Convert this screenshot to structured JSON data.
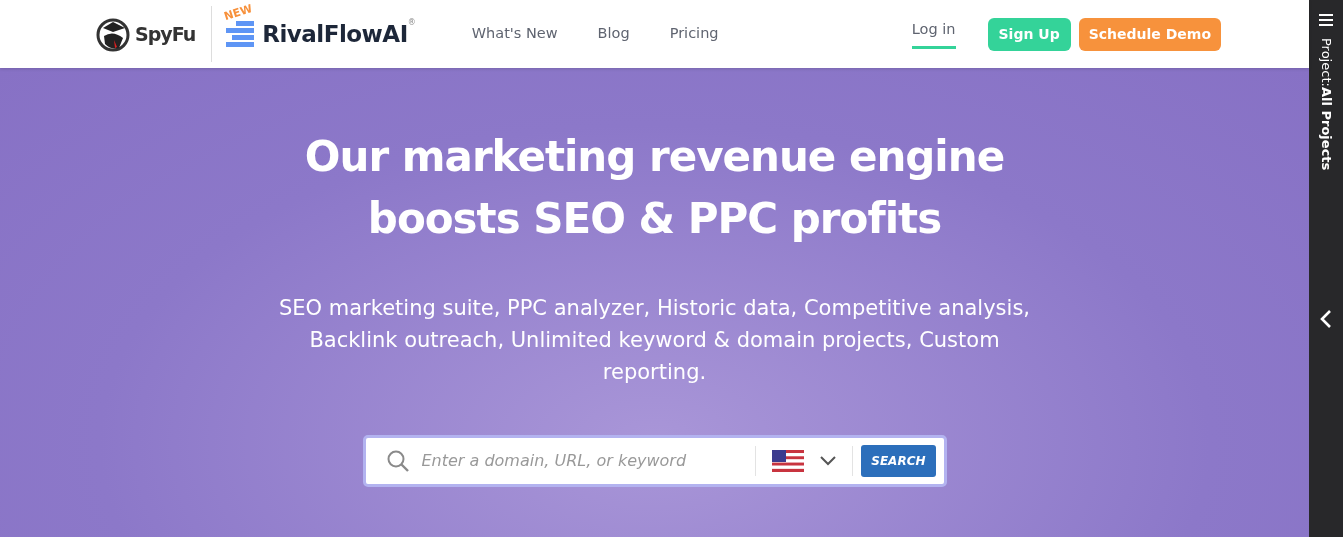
{
  "header": {
    "logo": "SpyFu",
    "product_badge": "NEW",
    "product_name": "RivalFlowAI",
    "product_mark": "®",
    "nav": [
      {
        "label": "What's New",
        "selected": false
      },
      {
        "label": "Blog",
        "selected": false
      },
      {
        "label": "Pricing",
        "selected": false
      }
    ],
    "login": {
      "label": "Log in",
      "selected": true
    },
    "buttons": [
      {
        "label": "Sign Up",
        "kind": "signup"
      },
      {
        "label": "Schedule Demo",
        "kind": "demo"
      }
    ]
  },
  "hero": {
    "title_lines": [
      "Our marketing revenue engine",
      "boosts SEO & PPC profits"
    ],
    "subtitle": "SEO marketing suite, PPC analyzer, Historic data, Competitive analysis, Backlink outreach, Unlimited keyword & domain projects, Custom reporting.",
    "search": {
      "placeholder": "Enter a domain, URL, or keyword",
      "button": "SEARCH"
    }
  },
  "side_panel": {
    "project_prefix": "Project:",
    "project_name": "All Projects"
  }
}
